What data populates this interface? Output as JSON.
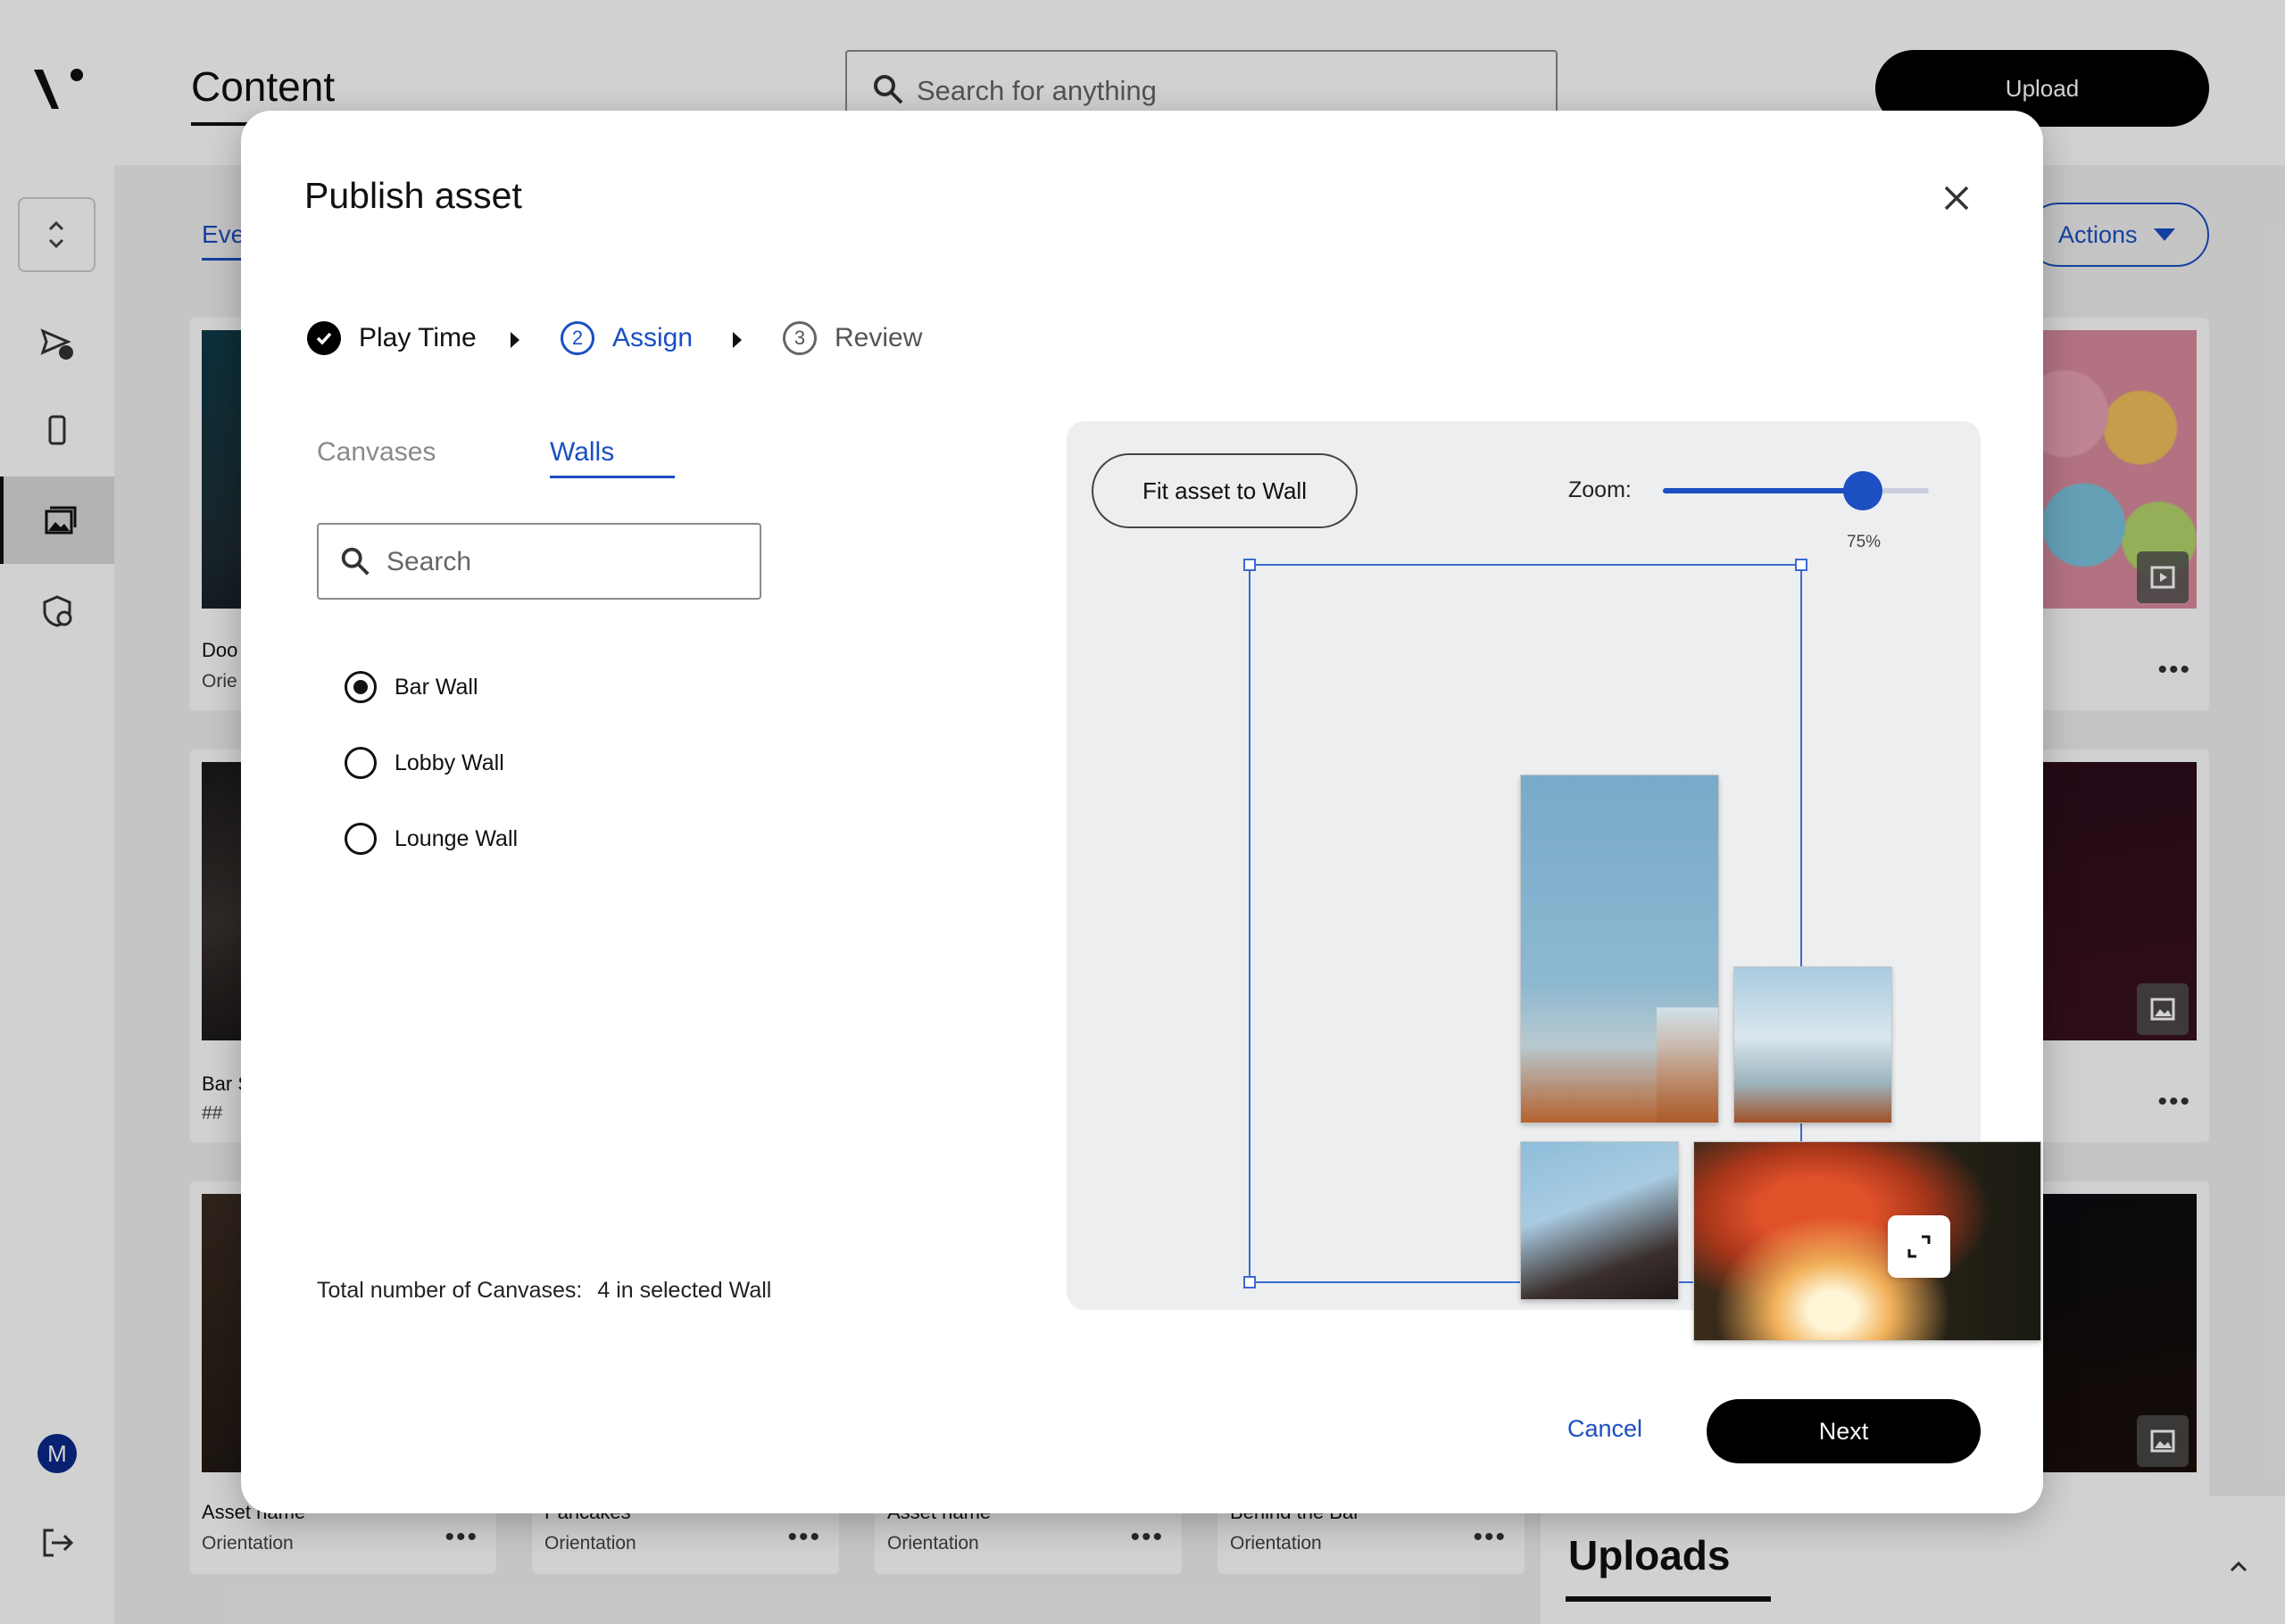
{
  "app": {
    "title": "Content",
    "search_placeholder": "Search for anything",
    "upload_label": "Upload",
    "avatar_initial": "M"
  },
  "background": {
    "tab_label": "Eve",
    "actions_label": "Actions",
    "cards": [
      {
        "name": "Doo",
        "sub": "Orie"
      },
      {
        "name": "Bar S",
        "sub": "##"
      },
      {
        "name": "Asset name",
        "sub": "Orientation"
      },
      {
        "name": "Pancakes",
        "sub": "Orientation"
      },
      {
        "name": "Asset name",
        "sub": "Orientation"
      },
      {
        "name": "Behind the Bar",
        "sub": "Orientation"
      }
    ],
    "uploads_title": "Uploads"
  },
  "dialog": {
    "title": "Publish asset",
    "steps": [
      {
        "label": "Play Time",
        "state": "complete"
      },
      {
        "label": "Assign",
        "number": "2",
        "state": "active"
      },
      {
        "label": "Review",
        "number": "3",
        "state": "upcoming"
      }
    ],
    "tabs": [
      {
        "label": "Canvases",
        "active": false
      },
      {
        "label": "Walls",
        "active": true
      }
    ],
    "search_placeholder": "Search",
    "walls": [
      {
        "label": "Bar Wall",
        "selected": true
      },
      {
        "label": "Lobby Wall",
        "selected": false
      },
      {
        "label": "Lounge Wall",
        "selected": false
      }
    ],
    "total_label": "Total number of Canvases:",
    "total_value": "4 in selected Wall",
    "fit_label": "Fit asset to Wall",
    "zoom_label": "Zoom:",
    "zoom_percent_label": "75%",
    "zoom_value": 0.75,
    "cancel_label": "Cancel",
    "next_label": "Next"
  },
  "colors": {
    "accent": "#1b4fc2",
    "primary_button": "#000000"
  },
  "icons": {
    "logo": "logo-mark",
    "search": "search-icon",
    "close": "close-icon",
    "check": "check-icon",
    "expand": "expand-icon"
  }
}
